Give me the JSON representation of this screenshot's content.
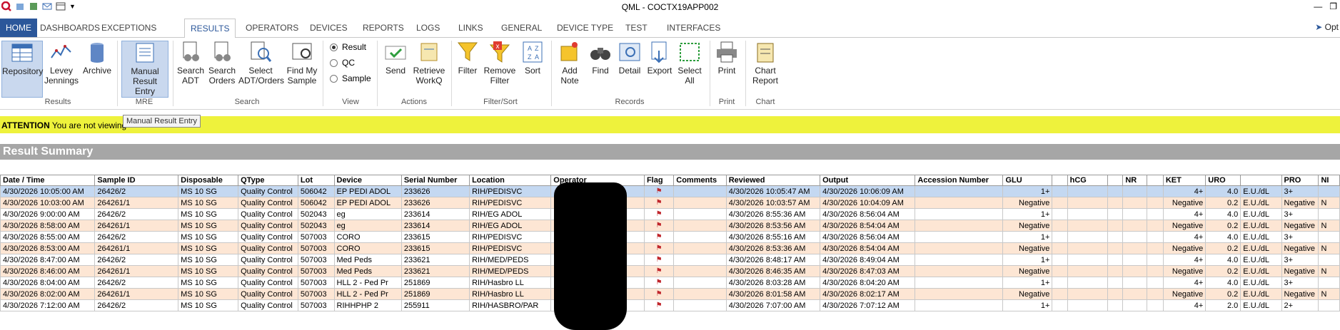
{
  "app": {
    "title": "QML - COCTX19APP002",
    "options_label": "Opt"
  },
  "tabs": [
    "HOME",
    "DASHBOARDS",
    "EXCEPTIONS",
    "RESULTS",
    "OPERATORS",
    "DEVICES",
    "REPORTS",
    "LOGS",
    "LINKS",
    "GENERAL",
    "DEVICE TYPE",
    "TEST",
    "INTERFACES"
  ],
  "ribbon": {
    "buttons": [
      {
        "label": "Repository",
        "icon": "repository-icon"
      },
      {
        "label": "Levey Jennings",
        "icon": "levey-jennings-chart-icon"
      },
      {
        "label": "Archive",
        "icon": "archive-icon"
      },
      {
        "label": "Manual Result Entry",
        "icon": "manual-entry-icon"
      },
      {
        "label": "Search ADT",
        "icon": "search-adt-icon"
      },
      {
        "label": "Search Orders",
        "icon": "search-orders-icon"
      },
      {
        "label": "Select ADT/Orders",
        "icon": "select-adt-orders-icon"
      },
      {
        "label": "Find My Sample",
        "icon": "find-sample-icon"
      },
      {
        "label": "Send",
        "icon": "send-icon"
      },
      {
        "label": "Retrieve WorkQ",
        "icon": "retrieve-workq-icon"
      },
      {
        "label": "Filter",
        "icon": "filter-icon"
      },
      {
        "label": "Remove Filter",
        "icon": "remove-filter-icon"
      },
      {
        "label": "Sort",
        "icon": "sort-icon"
      },
      {
        "label": "Add Note",
        "icon": "add-note-icon"
      },
      {
        "label": "Find",
        "icon": "binoculars-icon"
      },
      {
        "label": "Detail",
        "icon": "detail-icon"
      },
      {
        "label": "Export",
        "icon": "export-icon"
      },
      {
        "label": "Select All",
        "icon": "select-all-icon"
      },
      {
        "label": "Print",
        "icon": "printer-icon"
      },
      {
        "label": "Chart Report",
        "icon": "chart-report-icon"
      }
    ],
    "view_options": [
      {
        "label": "Result",
        "selected": true
      },
      {
        "label": "QC",
        "selected": false
      },
      {
        "label": "Sample",
        "selected": false
      }
    ],
    "groups": [
      "Results",
      "MRE",
      "Search",
      "View",
      "Actions",
      "Filter/Sort",
      "Records",
      "Print",
      "Chart"
    ]
  },
  "tooltip": "Manual Result Entry",
  "attention": {
    "label": "ATTENTION",
    "text": "You are not viewing"
  },
  "summary_title": "Result Summary",
  "table": {
    "columns": [
      "Date / Time",
      "Sample ID",
      "Disposable",
      "QType",
      "Lot",
      "Device",
      "Serial Number",
      "Location",
      "Operator",
      "Flag",
      "Comments",
      "Reviewed",
      "Output",
      "Accession Number",
      "GLU",
      "",
      "hCG",
      "",
      "NR",
      "",
      "KET",
      "URO",
      "",
      "PRO",
      "NI"
    ],
    "rows": [
      [
        "4/30/2026 10:05:00 AM",
        "26426/2",
        "MS 10 SG",
        "Quality Control",
        "506042",
        "EP PEDI ADOL",
        "233626",
        "RIH/PEDISVC",
        "",
        "flag",
        "",
        "4/30/2026 10:05:47 AM",
        "4/30/2026 10:06:09 AM",
        "",
        "1+",
        "",
        "",
        "",
        "",
        "",
        "4+",
        "4.0",
        "E.U./dL",
        "3+",
        ""
      ],
      [
        "4/30/2026 10:03:00 AM",
        "264261/1",
        "MS 10 SG",
        "Quality Control",
        "506042",
        "EP PEDI ADOL",
        "233626",
        "RIH/PEDISVC",
        "",
        "flag",
        "",
        "4/30/2026 10:03:57 AM",
        "4/30/2026 10:04:09 AM",
        "",
        "Negative",
        "",
        "",
        "",
        "",
        "",
        "Negative",
        "0.2",
        "E.U./dL",
        "Negative",
        "N"
      ],
      [
        "4/30/2026 9:00:00 AM",
        "26426/2",
        "MS 10 SG",
        "Quality Control",
        "502043",
        "eg",
        "233614",
        "RIH/EG ADOL",
        "",
        "flag",
        "",
        "4/30/2026 8:55:36 AM",
        "4/30/2026 8:56:04 AM",
        "",
        "1+",
        "",
        "",
        "",
        "",
        "",
        "4+",
        "4.0",
        "E.U./dL",
        "3+",
        ""
      ],
      [
        "4/30/2026 8:58:00 AM",
        "264261/1",
        "MS 10 SG",
        "Quality Control",
        "502043",
        "eg",
        "233614",
        "RIH/EG ADOL",
        "",
        "flag",
        "",
        "4/30/2026 8:53:56 AM",
        "4/30/2026 8:54:04 AM",
        "",
        "Negative",
        "",
        "",
        "",
        "",
        "",
        "Negative",
        "0.2",
        "E.U./dL",
        "Negative",
        "N"
      ],
      [
        "4/30/2026 8:55:00 AM",
        "26426/2",
        "MS 10 SG",
        "Quality Control",
        "507003",
        "CORO",
        "233615",
        "RIH/PEDISVC",
        "",
        "flag",
        "",
        "4/30/2026 8:55:16 AM",
        "4/30/2026 8:56:04 AM",
        "",
        "1+",
        "",
        "",
        "",
        "",
        "",
        "4+",
        "4.0",
        "E.U./dL",
        "3+",
        ""
      ],
      [
        "4/30/2026 8:53:00 AM",
        "264261/1",
        "MS 10 SG",
        "Quality Control",
        "507003",
        "CORO",
        "233615",
        "RIH/PEDISVC",
        "",
        "flag",
        "",
        "4/30/2026 8:53:36 AM",
        "4/30/2026 8:54:04 AM",
        "",
        "Negative",
        "",
        "",
        "",
        "",
        "",
        "Negative",
        "0.2",
        "E.U./dL",
        "Negative",
        "N"
      ],
      [
        "4/30/2026 8:47:00 AM",
        "26426/2",
        "MS 10 SG",
        "Quality Control",
        "507003",
        "Med Peds",
        "233621",
        "RIH/MED/PEDS",
        "",
        "flag",
        "",
        "4/30/2026 8:48:17 AM",
        "4/30/2026 8:49:04 AM",
        "",
        "1+",
        "",
        "",
        "",
        "",
        "",
        "4+",
        "4.0",
        "E.U./dL",
        "3+",
        ""
      ],
      [
        "4/30/2026 8:46:00 AM",
        "264261/1",
        "MS 10 SG",
        "Quality Control",
        "507003",
        "Med Peds",
        "233621",
        "RIH/MED/PEDS",
        "",
        "flag",
        "",
        "4/30/2026 8:46:35 AM",
        "4/30/2026 8:47:03 AM",
        "",
        "Negative",
        "",
        "",
        "",
        "",
        "",
        "Negative",
        "0.2",
        "E.U./dL",
        "Negative",
        "N"
      ],
      [
        "4/30/2026 8:04:00 AM",
        "26426/2",
        "MS 10 SG",
        "Quality Control",
        "507003",
        "HLL 2 - Ped Pr",
        "251869",
        "RIH/Hasbro LL",
        "",
        "flag",
        "",
        "4/30/2026 8:03:28 AM",
        "4/30/2026 8:04:20 AM",
        "",
        "1+",
        "",
        "",
        "",
        "",
        "",
        "4+",
        "4.0",
        "E.U./dL",
        "3+",
        ""
      ],
      [
        "4/30/2026 8:02:00 AM",
        "264261/1",
        "MS 10 SG",
        "Quality Control",
        "507003",
        "HLL 2 - Ped Pr",
        "251869",
        "RIH/Hasbro LL",
        "",
        "flag",
        "",
        "4/30/2026 8:01:58 AM",
        "4/30/2026 8:02:17 AM",
        "",
        "Negative",
        "",
        "",
        "",
        "",
        "",
        "Negative",
        "0.2",
        "E.U./dL",
        "Negative",
        "N"
      ],
      [
        "4/30/2026 7:12:00 AM",
        "26426/2",
        "MS 10 SG",
        "Quality Control",
        "507003",
        "RIHHPHP 2",
        "255911",
        "RIH/HASBRO/PAR",
        "",
        "flag",
        "",
        "4/30/2026 7:07:00 AM",
        "4/30/2026 7:07:12 AM",
        "",
        "1+",
        "",
        "",
        "",
        "",
        "",
        "4+",
        "2.0",
        "E.U./dL",
        "2+",
        ""
      ]
    ]
  },
  "colors": {
    "home_tab": "#2b579a",
    "attention": "#eef23c",
    "row_alt": "#fde6d4",
    "row_selected": "#c4d8f1",
    "summary_bar": "#a6a6a6",
    "flag": "#c0262c"
  }
}
